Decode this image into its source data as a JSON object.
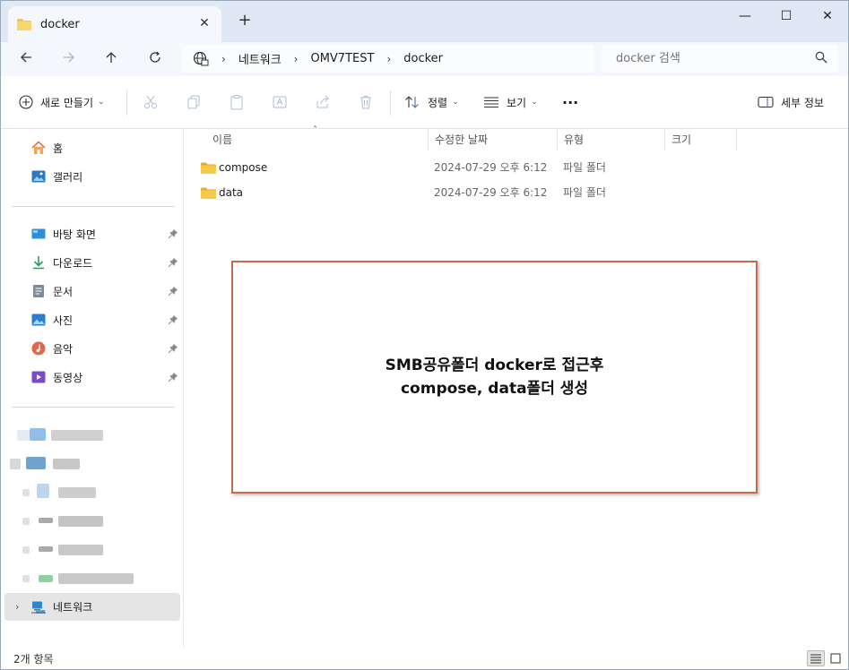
{
  "window": {
    "tab_title": "docker",
    "tab_close": "✕",
    "new_tab": "+",
    "minimize": "—",
    "maximize": "☐",
    "close": "✕"
  },
  "address": {
    "breadcrumbs": [
      "네트워크",
      "OMV7TEST",
      "docker"
    ],
    "search_placeholder": "docker 검색"
  },
  "toolbar": {
    "new_label": "새로 만들기",
    "sort_label": "정렬",
    "view_label": "보기",
    "more_label": "···",
    "details_label": "세부 정보"
  },
  "sidebar": {
    "home": "홈",
    "gallery": "갤러리",
    "pinned": [
      {
        "label": "바탕 화면",
        "icon": "desktop-icon"
      },
      {
        "label": "다운로드",
        "icon": "download-icon"
      },
      {
        "label": "문서",
        "icon": "documents-icon"
      },
      {
        "label": "사진",
        "icon": "pictures-icon"
      },
      {
        "label": "음악",
        "icon": "music-icon"
      },
      {
        "label": "동영상",
        "icon": "videos-icon"
      }
    ],
    "network": "네트워크"
  },
  "columns": {
    "name": "이름",
    "date": "수정한 날짜",
    "type": "유형",
    "size": "크기"
  },
  "files": [
    {
      "name": "compose",
      "date": "2024-07-29 오후 6:12",
      "type": "파일 폴더"
    },
    {
      "name": "data",
      "date": "2024-07-29 오후 6:12",
      "type": "파일 폴더"
    }
  ],
  "annotation": {
    "line1": "SMB공유폴더 docker로 접근후",
    "line2": "compose, data폴더 생성"
  },
  "status": {
    "item_count": "2개 항목"
  },
  "colors": {
    "folder": "#f5c54a",
    "annotation_border": "#c86a4e",
    "titlebar": "#dfe8f4"
  }
}
